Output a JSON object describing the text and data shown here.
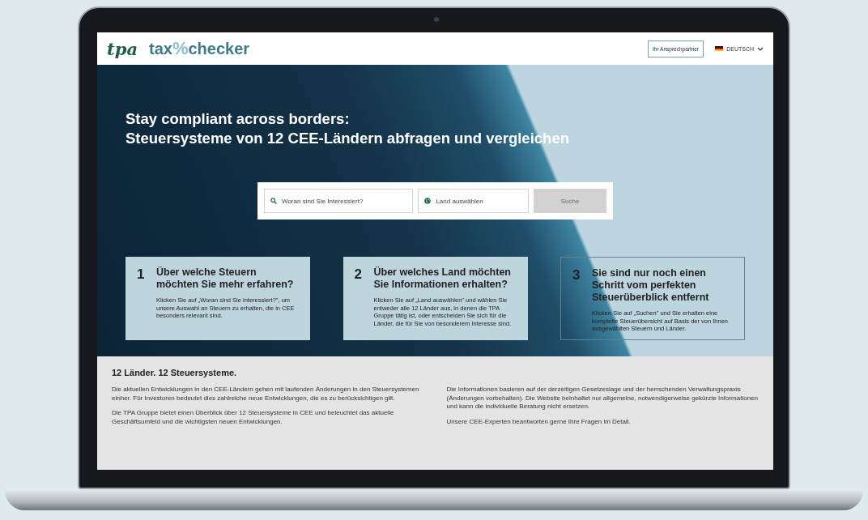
{
  "header": {
    "logo_left": "tpa",
    "logo_brand_start": "tax",
    "logo_brand_symbol": "%",
    "logo_brand_end": "checker",
    "contact_button": "Ihr Ansprechpartner",
    "language": "DEUTSCH"
  },
  "hero": {
    "headline_lines": [
      "Stay compliant across borders:",
      "Steuersysteme von 12 CEE-Ländern abfragen und vergleichen"
    ],
    "search": {
      "topic_placeholder": "Woran sind Sie Interessiert?",
      "country_placeholder": "Land auswählen",
      "button": "Suche",
      "button_disabled": true
    },
    "steps": [
      {
        "kind": "filled",
        "number": "1",
        "title": "Über welche Steuern möchten Sie mehr erfahren?",
        "text": "Klicken Sie auf „Woran sind Sie interessiert?\", um unsere Auswahl an Steuern zu erhalten, die in CEE besonders relevant sind."
      },
      {
        "kind": "filled",
        "number": "2",
        "title": "Über welches Land möchten Sie Informationen erhalten?",
        "text": "Klicken Sie auf „Land auswählen\" und wählen Sie entweder alle 12 Länder aus, in denen die TPA Gruppe tätig ist, oder entscheiden Sie sich für die Länder, die für Sie von besonderem Interesse sind."
      },
      {
        "kind": "outlined",
        "number": "3",
        "title": "Sie sind nur noch einen Schritt vom perfekten Steuerüberblick entfernt",
        "text": "Klicken Sie auf „Suchen\" und Sie erhalten eine komplette Steuerübersicht auf Basis der von Ihnen ausgewählten Steuern und Länder."
      }
    ]
  },
  "info": {
    "heading": "12 Länder. 12 Steuersysteme.",
    "columns": [
      [
        "Die aktuellen Entwicklungen in den CEE-Ländern gehen mit laufenden Änderungen in den Steuersystemen einher. Für Investoren bedeutet dies zahlreiche neue Entwicklungen, die es zu berücksichtigen gilt.",
        "Die TPA Gruppe bietet einen Überblick über 12 Steuersysteme in CEE und beleuchtet das aktuelle Geschäftsumfeld und die wichtigsten neuen Entwicklungen."
      ],
      [
        "Die Informationen basieren auf der derzeitigen Gesetzeslage und der herrschenden Verwaltungspraxis (Änderungen vorbehalten). Die Website beinhaltet nur allgemeine, notwendigerweise gekürzte Informationen und kann die individuelle Beratung nicht ersetzen.",
        "Unsere CEE-Experten beantworten gerne Ihre Fragen im Detail."
      ]
    ]
  }
}
